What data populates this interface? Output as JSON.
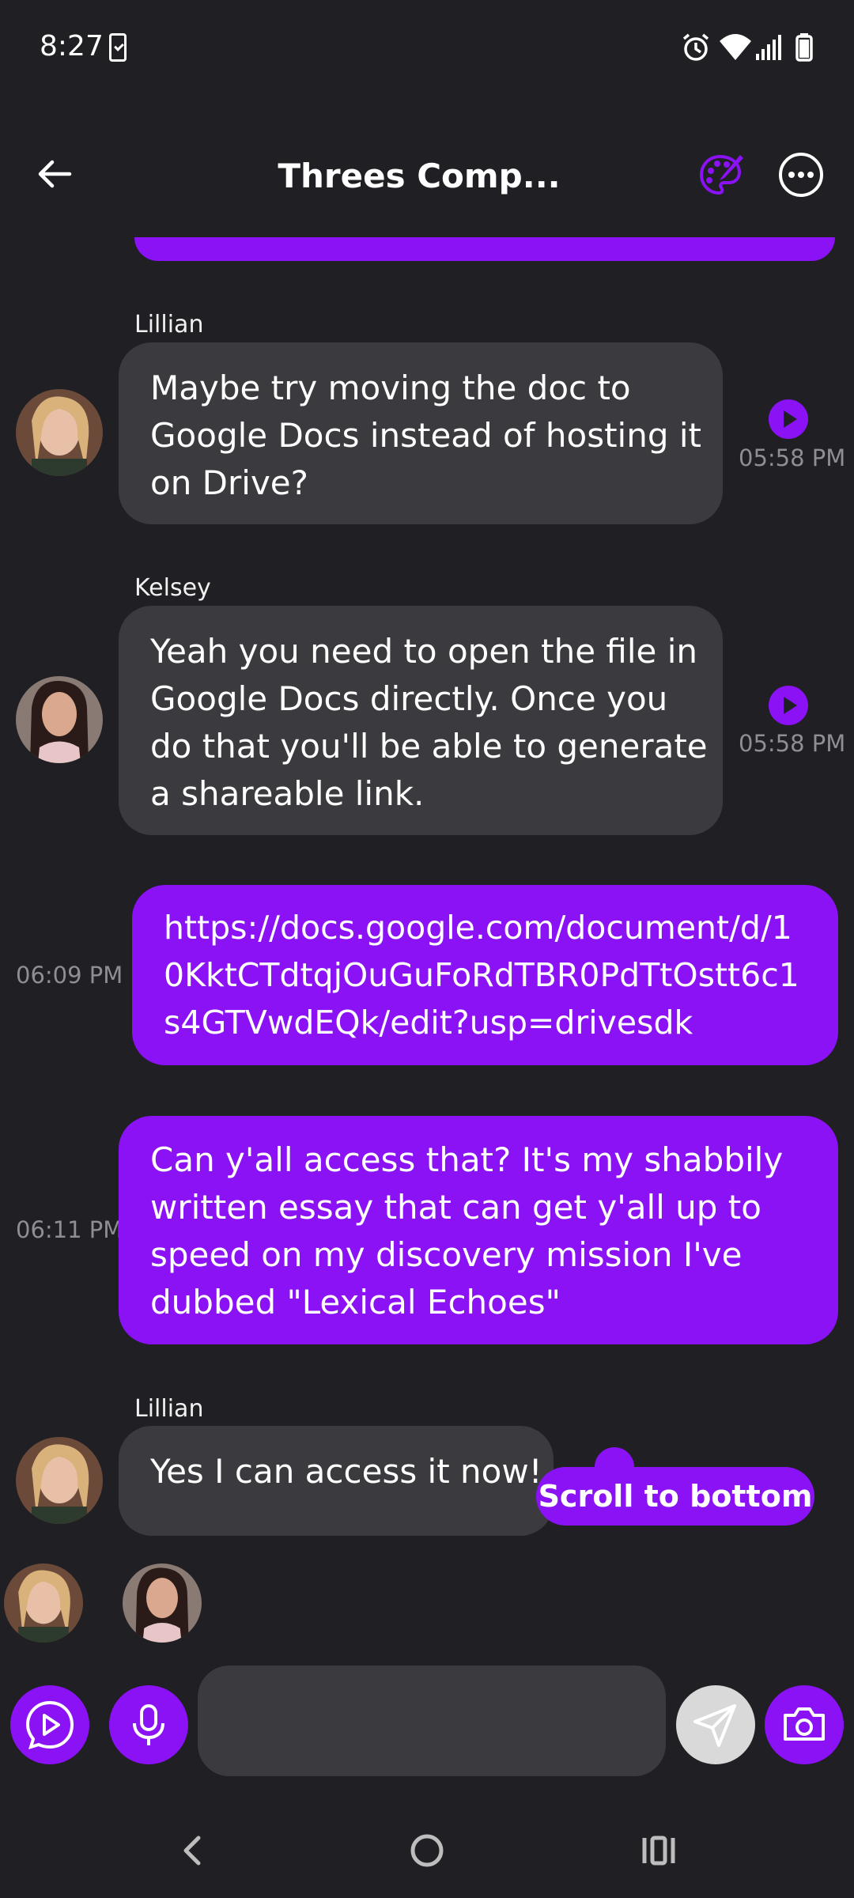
{
  "status_bar": {
    "time": "8:27"
  },
  "header": {
    "title": "Threes Comp...",
    "back_icon": "arrow-left-icon",
    "palette_icon": "palette-icon",
    "more_icon": "more-horizontal-icon"
  },
  "messages": [
    {
      "sender": "Lillian",
      "direction": "incoming",
      "lines": [
        "Maybe try moving the doc to",
        "Google Docs instead of hosting it",
        "on Drive?"
      ],
      "time": "05:58 PM"
    },
    {
      "sender": "Kelsey",
      "direction": "incoming",
      "lines": [
        "Yeah you need to open the file in",
        "Google Docs directly. Once you",
        "do that you'll be able to generate",
        "a shareable link."
      ],
      "time": "05:58 PM"
    },
    {
      "direction": "outgoing",
      "lines": [
        "https://docs.google.com/document/d/1",
        "0KktCTdtqjOuGuFoRdTBR0PdTtOstt6c1",
        "s4GTVwdEQk/edit?usp=drivesdk"
      ],
      "time": "06:09 PM"
    },
    {
      "direction": "outgoing",
      "lines": [
        "Can y'all access that? It's my shabbily",
        "written essay that can get y'all up to",
        "speed on my discovery mission I've",
        "dubbed \"Lexical Echoes\""
      ],
      "time": "06:11 PM"
    },
    {
      "sender": "Lillian",
      "direction": "incoming",
      "lines": [
        "Yes I can access it now!"
      ]
    }
  ],
  "scroll_button": {
    "label": "Scroll to bottom"
  },
  "composer": {
    "input_value": "",
    "video_icon": "play-message-icon",
    "mic_icon": "microphone-icon",
    "send_icon": "send-icon",
    "camera_icon": "camera-icon"
  },
  "colors": {
    "accent": "#8a12f5",
    "background": "#1f1f24",
    "incoming_bubble": "#3a3a3f",
    "timestamp": "#8e8e93",
    "send_button": "#d9d9d9"
  }
}
